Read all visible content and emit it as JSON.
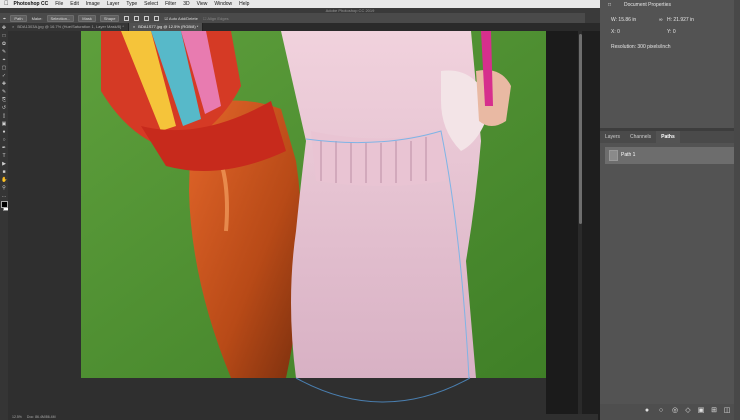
{
  "menubar": {
    "apple": "",
    "items": [
      "Photoshop CC",
      "File",
      "Edit",
      "Image",
      "Layer",
      "Type",
      "Select",
      "Filter",
      "3D",
      "View",
      "Window",
      "Help"
    ]
  },
  "window": {
    "title": "Adobe Photoshop CC 2019"
  },
  "options": {
    "mode": "Path",
    "make_label": "Make:",
    "selection_btn": "Selection...",
    "mask_btn": "Mask",
    "shape_btn": "Shape",
    "auto_add_delete": "Auto Add/Delete",
    "align_edges": "Align Edges"
  },
  "tabs": [
    {
      "label": "BDA1303A.jpg @ 16.7% (Hue/Saturation 1, Layer Mask/8) *",
      "active": false
    },
    {
      "label": "BDA1S77.jpg @ 12.5% (RGB/8) *",
      "active": true
    }
  ],
  "status": {
    "zoom": "12.5%",
    "doc": "Doc: 86.4M/86.4M"
  },
  "properties": {
    "title": "Document Properties",
    "w_label": "W:",
    "w_value": "15.86 in",
    "h_label": "H:",
    "h_value": "21.927 in",
    "x_label": "X:",
    "x_value": "0",
    "y_label": "Y:",
    "y_value": "0",
    "resolution": "Resolution: 300 pixels/inch"
  },
  "panel_tabs": [
    "Layers",
    "Channels",
    "Paths"
  ],
  "paths": [
    {
      "name": "Path 1"
    }
  ],
  "colors": {
    "background": "#5c9f3a",
    "accent": "#c62828",
    "path": "#7fb4e6"
  }
}
